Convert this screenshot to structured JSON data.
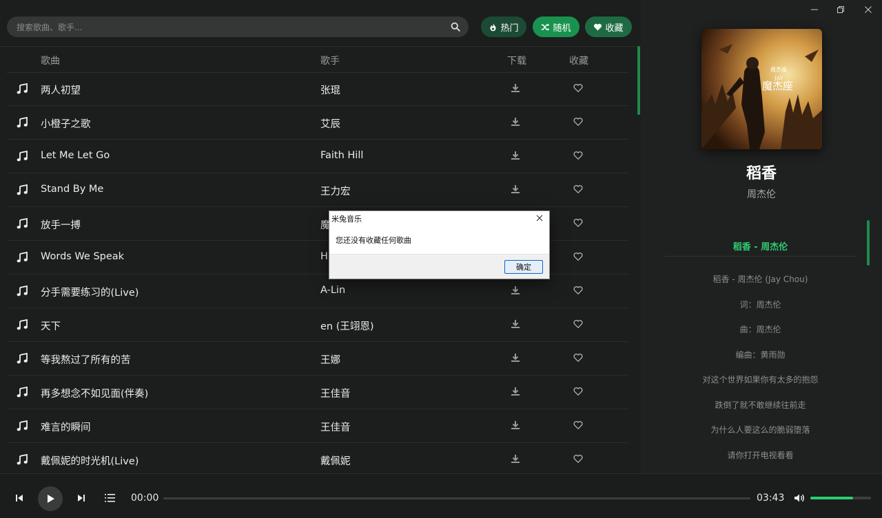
{
  "search": {
    "placeholder": "搜索歌曲、歌手..."
  },
  "top_buttons": {
    "hot": "热门",
    "random": "随机",
    "favorites": "收藏"
  },
  "table": {
    "headers": {
      "song": "歌曲",
      "artist": "歌手",
      "download": "下载",
      "favorite": "收藏"
    },
    "rows": [
      {
        "title": "两人初望",
        "artist": "张琨"
      },
      {
        "title": "小橙子之歌",
        "artist": "艾辰"
      },
      {
        "title": "Let Me Let Go",
        "artist": "Faith Hill"
      },
      {
        "title": "Stand By Me",
        "artist": "王力宏"
      },
      {
        "title": "放手一搏",
        "artist": "魔"
      },
      {
        "title": "Words We Speak",
        "artist": "H"
      },
      {
        "title": "分手需要练习的(Live)",
        "artist": "A-Lin"
      },
      {
        "title": "天下",
        "artist": "en (王翊恩)"
      },
      {
        "title": "等我熬过了所有的苦",
        "artist": "王娜"
      },
      {
        "title": "再多想念不如见面(伴奏)",
        "artist": "王佳音"
      },
      {
        "title": "难言的瞬间",
        "artist": "王佳音"
      },
      {
        "title": "戴佩妮的时光机(Live)",
        "artist": "戴佩妮"
      }
    ]
  },
  "now_playing": {
    "title": "稻香",
    "artist": "周杰伦",
    "cover_text_artist": "周杰倫",
    "cover_text_brand": "JAY",
    "cover_text_album": "魔杰座"
  },
  "lyrics": {
    "header": "稻香 - 周杰伦",
    "lines": [
      "稻香 - 周杰伦 (Jay Chou)",
      "词：周杰伦",
      "曲：周杰伦",
      "编曲：黄雨勋",
      "对这个世界如果你有太多的抱怨",
      "跌倒了就不敢继续往前走",
      "为什么人要这么的脆弱堕落",
      "请你打开电视看看"
    ]
  },
  "player": {
    "current_time": "00:00",
    "total_time": "03:43",
    "progress": 0,
    "volume": 0.7
  },
  "dialog": {
    "title": "米兔音乐",
    "message": "您还没有收藏任何歌曲",
    "ok": "确定"
  },
  "colors": {
    "accent": "#2ecc71",
    "accent_dark": "#19924f",
    "background": "#1c1d1d"
  },
  "icons": {
    "search": "search-icon",
    "hot": "fire-icon",
    "random": "shuffle-icon",
    "favorites": "heart-icon",
    "row_note": "music-note-icon",
    "row_download": "download-icon",
    "row_favorite": "heart-outline-icon",
    "prev": "skip-previous-icon",
    "play": "play-icon",
    "next": "skip-next-icon",
    "playlist": "playlist-icon",
    "volume": "volume-icon",
    "minimize": "minimize-icon",
    "restore": "restore-icon",
    "close": "close-icon"
  }
}
